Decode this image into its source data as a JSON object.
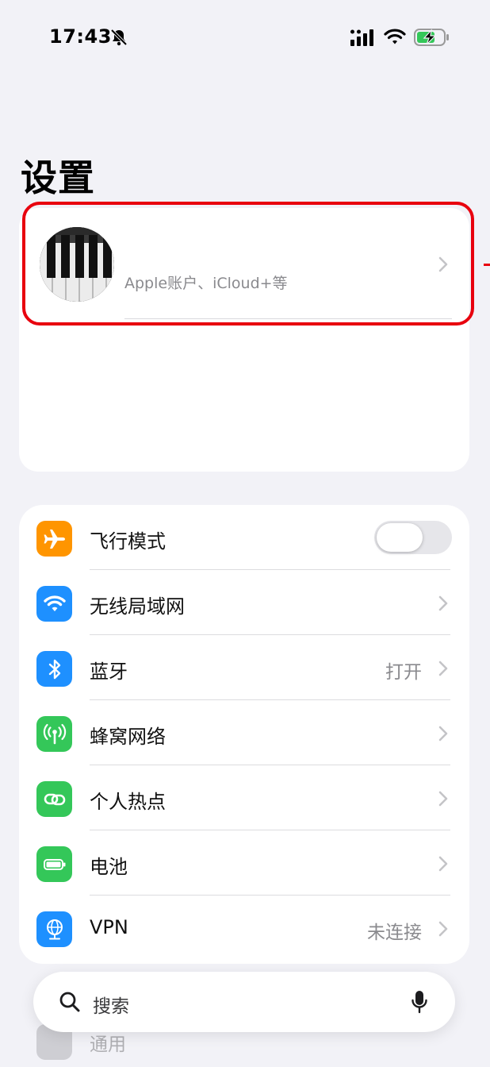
{
  "status_bar": {
    "time": "17:43",
    "icons": [
      "bell-slash-icon",
      "cellular-signal-icon",
      "wifi-icon",
      "battery-charging-icon"
    ]
  },
  "page": {
    "title": "设置"
  },
  "account": {
    "subtitle": "Apple账户、iCloud+等",
    "avatar_icon": "piano-keys-avatar"
  },
  "settings": [
    {
      "id": "airplane",
      "label": "飞行模式",
      "value": "",
      "control": "toggle",
      "toggle_on": false,
      "icon": "airplane-icon",
      "color": "#ff9500"
    },
    {
      "id": "wifi",
      "label": "无线局域网",
      "value": "",
      "control": "chevron",
      "icon": "wifi-icon",
      "color": "#1e90ff"
    },
    {
      "id": "bluetooth",
      "label": "蓝牙",
      "value": "打开",
      "control": "chevron",
      "icon": "bluetooth-icon",
      "color": "#1e90ff"
    },
    {
      "id": "cellular",
      "label": "蜂窝网络",
      "value": "",
      "control": "chevron",
      "icon": "cellular-antenna-icon",
      "color": "#34c759"
    },
    {
      "id": "hotspot",
      "label": "个人热点",
      "value": "",
      "control": "chevron",
      "icon": "hotspot-link-icon",
      "color": "#34c759"
    },
    {
      "id": "battery",
      "label": "电池",
      "value": "",
      "control": "chevron",
      "icon": "battery-icon",
      "color": "#34c759"
    },
    {
      "id": "vpn",
      "label": "VPN",
      "value": "未连接",
      "control": "chevron",
      "icon": "vpn-globe-icon",
      "color": "#1e90ff"
    }
  ],
  "search": {
    "placeholder": "搜索"
  },
  "behind": {
    "label": "通用",
    "icon": "gear-icon"
  },
  "colors": {
    "highlight": "#e8000e",
    "background": "#f2f2f7"
  }
}
